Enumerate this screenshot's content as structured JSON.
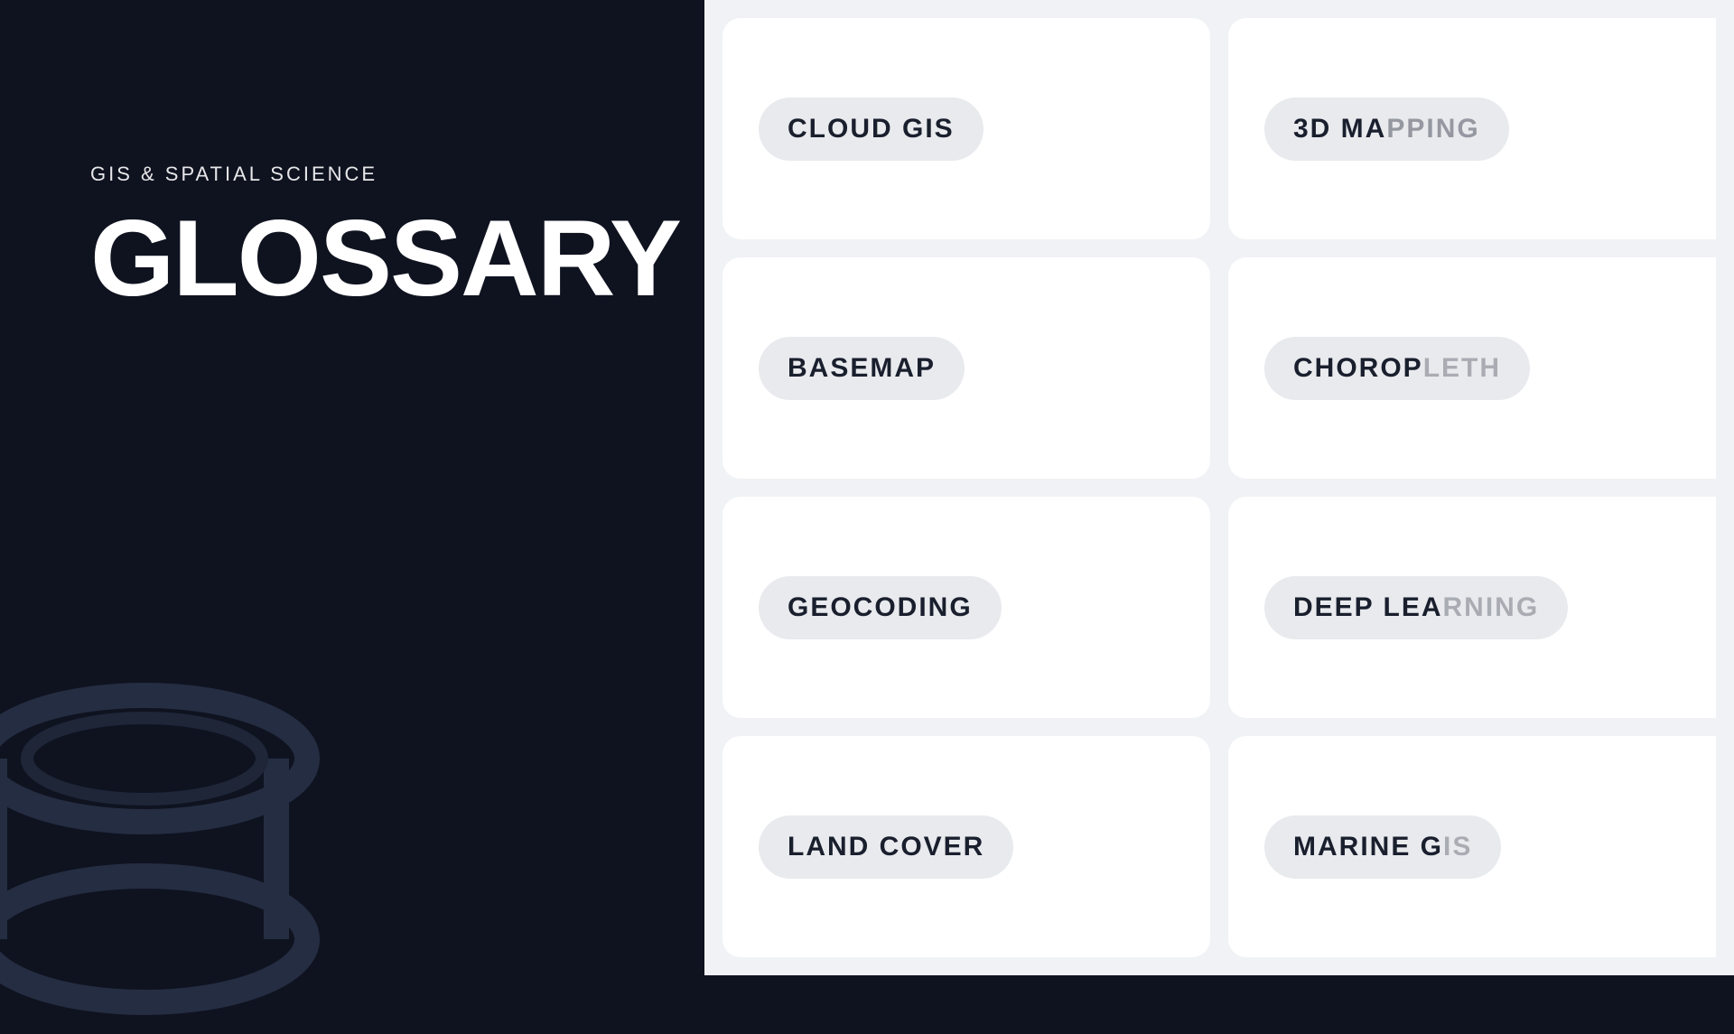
{
  "left": {
    "subtitle": "GIS & SPATIAL SCIENCE",
    "title": "GLOSSARY"
  },
  "cards": [
    {
      "id": "cloud-gis",
      "label": "CLOUD GIS",
      "partial": false
    },
    {
      "id": "3d-mapping",
      "label": "3D MA",
      "partial": true
    },
    {
      "id": "basemap",
      "label": "BASEMAP",
      "partial": false
    },
    {
      "id": "choropleth",
      "label": "CHOROP",
      "partial": true
    },
    {
      "id": "geocoding",
      "label": "GEOCODING",
      "partial": false
    },
    {
      "id": "deep-learning",
      "label": "DEEP LEA",
      "partial": true
    },
    {
      "id": "land-cover",
      "label": "LAND COVER",
      "partial": false
    },
    {
      "id": "marine",
      "label": "MARINE G",
      "partial": true
    }
  ],
  "colors": {
    "background_dark": "#0f1320",
    "background_light": "#f0f2f5",
    "card_bg": "#ffffff",
    "label_bg": "#e8eaed",
    "text_dark": "#1a1f2e",
    "text_white": "#ffffff"
  }
}
